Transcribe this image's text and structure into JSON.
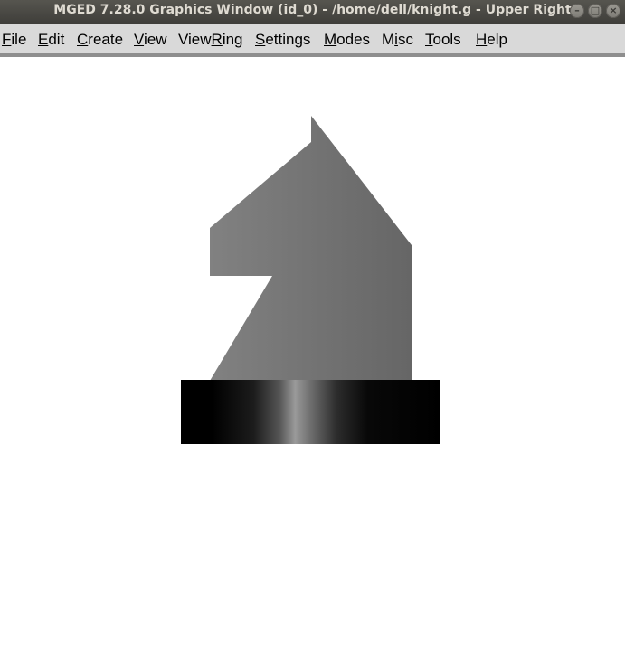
{
  "window": {
    "title": "MGED 7.28.0 Graphics Window (id_0) - /home/dell/knight.g - Upper Right",
    "buttons": {
      "minimize": "–",
      "maximize": "□",
      "close": "×"
    }
  },
  "menubar": {
    "items": [
      {
        "name": "file",
        "pre": "",
        "mnemonic": "F",
        "post": "ile"
      },
      {
        "name": "edit",
        "pre": "",
        "mnemonic": "E",
        "post": "dit"
      },
      {
        "name": "create",
        "pre": "",
        "mnemonic": "C",
        "post": "reate"
      },
      {
        "name": "view",
        "pre": "",
        "mnemonic": "V",
        "post": "iew"
      },
      {
        "name": "viewring",
        "pre": "View",
        "mnemonic": "R",
        "post": "ing"
      },
      {
        "name": "settings",
        "pre": "",
        "mnemonic": "S",
        "post": "ettings"
      },
      {
        "name": "modes",
        "pre": "",
        "mnemonic": "M",
        "post": "odes"
      },
      {
        "name": "misc",
        "pre": "M",
        "mnemonic": "i",
        "post": "sc"
      },
      {
        "name": "tools",
        "pre": "",
        "mnemonic": "T",
        "post": "ools"
      },
      {
        "name": "help",
        "pre": "",
        "mnemonic": "H",
        "post": "elp"
      }
    ]
  },
  "colors": {
    "titlebar": "#4a4945",
    "menubar": "#d9d9d9",
    "canvas_background": "#ffffff",
    "knight_light": "#808080",
    "knight_dark": "#676767",
    "base_dark": "#000000",
    "base_highlight": "#9a9a9a"
  }
}
